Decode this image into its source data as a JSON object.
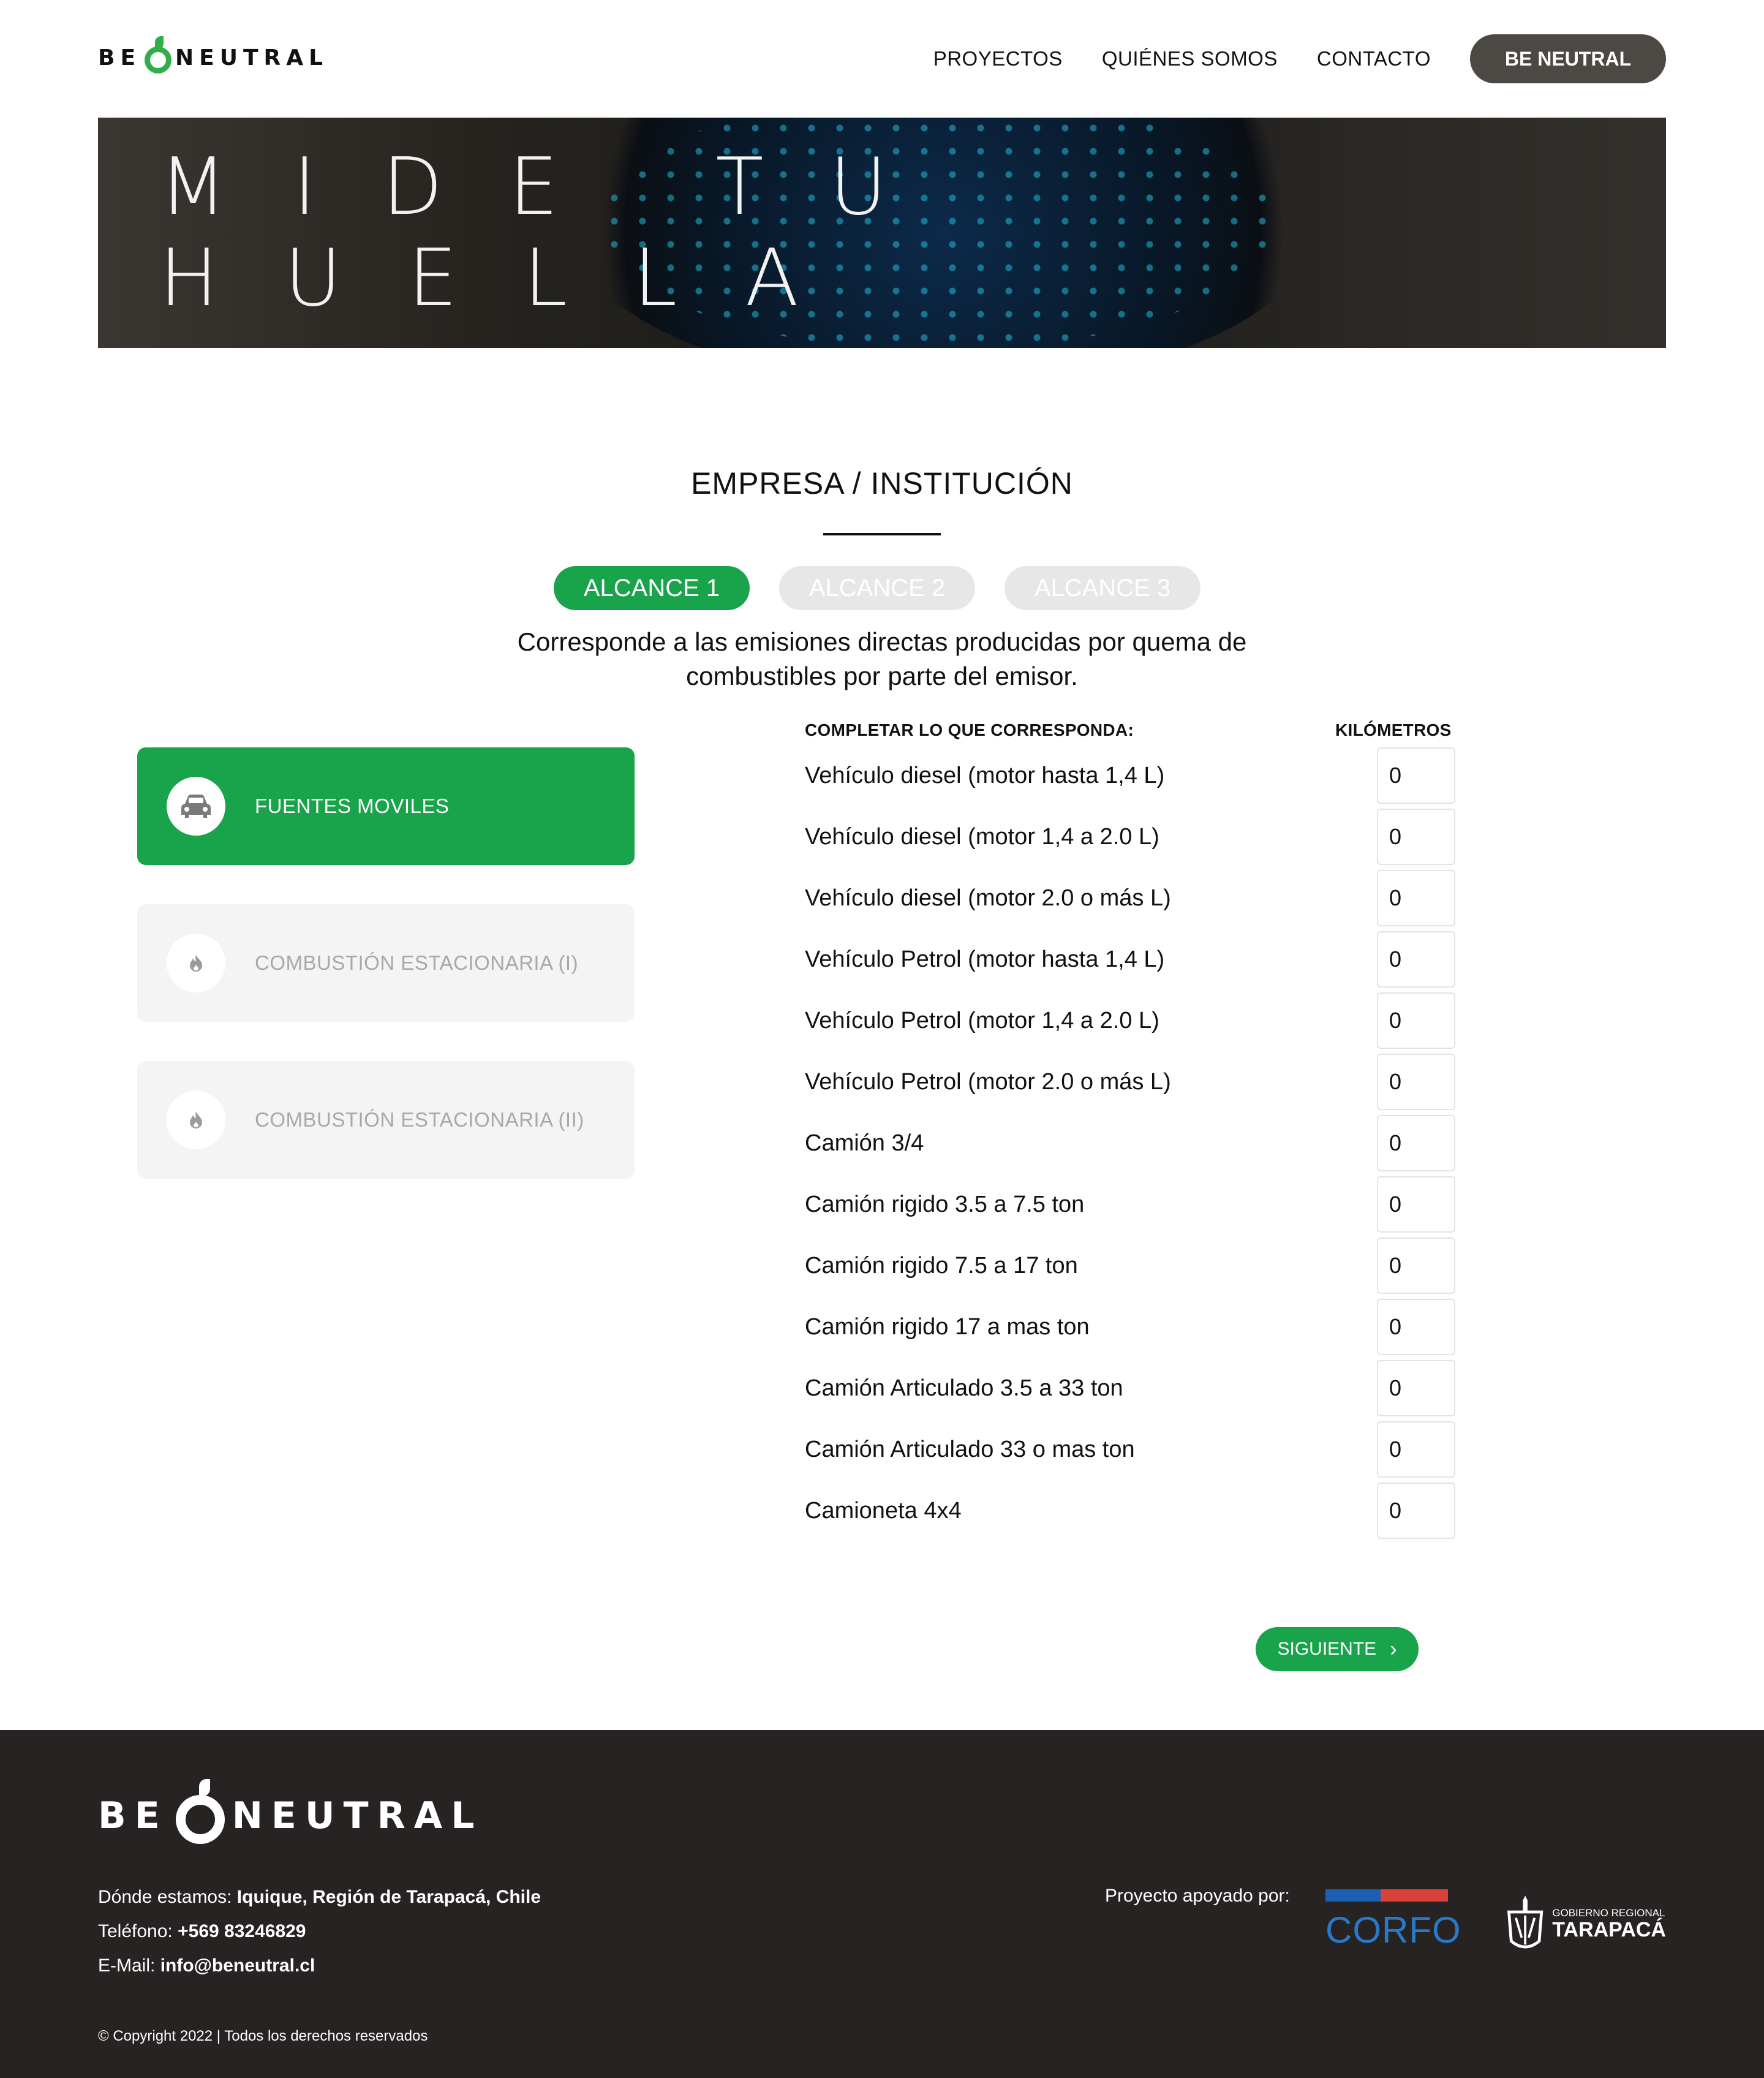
{
  "header": {
    "logo_text": "BE NEUTRAL",
    "nav": [
      "PROYECTOS",
      "QUIÉNES SOMOS",
      "CONTACTO"
    ],
    "cta": "BE NEUTRAL"
  },
  "hero": {
    "title": "MIDE TU HUELLA"
  },
  "section": {
    "title": "EMPRESA / INSTITUCIÓN",
    "tabs": [
      "ALCANCE 1",
      "ALCANCE 2",
      "ALCANCE 3"
    ],
    "active_tab": "ALCANCE 1",
    "description_line1": "Corresponde a las emisiones directas producidas por quema de",
    "description_line2": "combustibles por parte del emisor."
  },
  "categories": [
    {
      "label": "FUENTES MOVILES",
      "icon": "car-icon",
      "active": true
    },
    {
      "label": "COMBUSTIÓN ESTACIONARIA (I)",
      "icon": "flame-icon",
      "active": false
    },
    {
      "label": "COMBUSTIÓN ESTACIONARIA (II)",
      "icon": "flame-icon",
      "active": false
    }
  ],
  "form": {
    "heading_left": "COMPLETAR LO QUE CORRESPONDA:",
    "heading_right": "KILÓMETROS",
    "rows": [
      {
        "label": "Vehículo diesel (motor hasta 1,4 L)",
        "value": "0"
      },
      {
        "label": "Vehículo diesel (motor 1,4 a 2.0 L)",
        "value": "0"
      },
      {
        "label": "Vehículo diesel (motor 2.0 o más L)",
        "value": "0"
      },
      {
        "label": "Vehículo Petrol (motor hasta 1,4 L)",
        "value": "0"
      },
      {
        "label": "Vehículo Petrol (motor 1,4 a 2.0 L)",
        "value": "0"
      },
      {
        "label": "Vehículo Petrol (motor 2.0 o más L)",
        "value": "0"
      },
      {
        "label": "Camión 3/4",
        "value": "0"
      },
      {
        "label": "Camión rigido 3.5 a 7.5 ton",
        "value": "0"
      },
      {
        "label": "Camión rigido 7.5 a 17 ton",
        "value": "0"
      },
      {
        "label": "Camión rigido 17 a mas ton",
        "value": "0"
      },
      {
        "label": "Camión Articulado 3.5 a 33 ton",
        "value": "0"
      },
      {
        "label": "Camión Articulado 33 o mas ton",
        "value": "0"
      },
      {
        "label": "Camioneta 4x4",
        "value": "0"
      }
    ],
    "next_label": "SIGUIENTE"
  },
  "footer": {
    "logo_text": "BE NEUTRAL",
    "location_label": "Dónde estamos:",
    "location_value": "Iquique, Región de Tarapacá, Chile",
    "phone_label": "Teléfono:",
    "phone_value": "+569 83246829",
    "email_label": "E-Mail:",
    "email_value": "info@beneutral.cl",
    "copyright": "© Copyright 2022 | Todos los derechos reservados",
    "support_label": "Proyecto apoyado por:",
    "corfo_text": "CORFO",
    "gob_small": "GOBIERNO REGIONAL",
    "gob_big": "TARAPACÁ"
  },
  "colors": {
    "brand_green": "#19a34a",
    "dark": "#262322",
    "cta_gray": "#4c4844"
  }
}
